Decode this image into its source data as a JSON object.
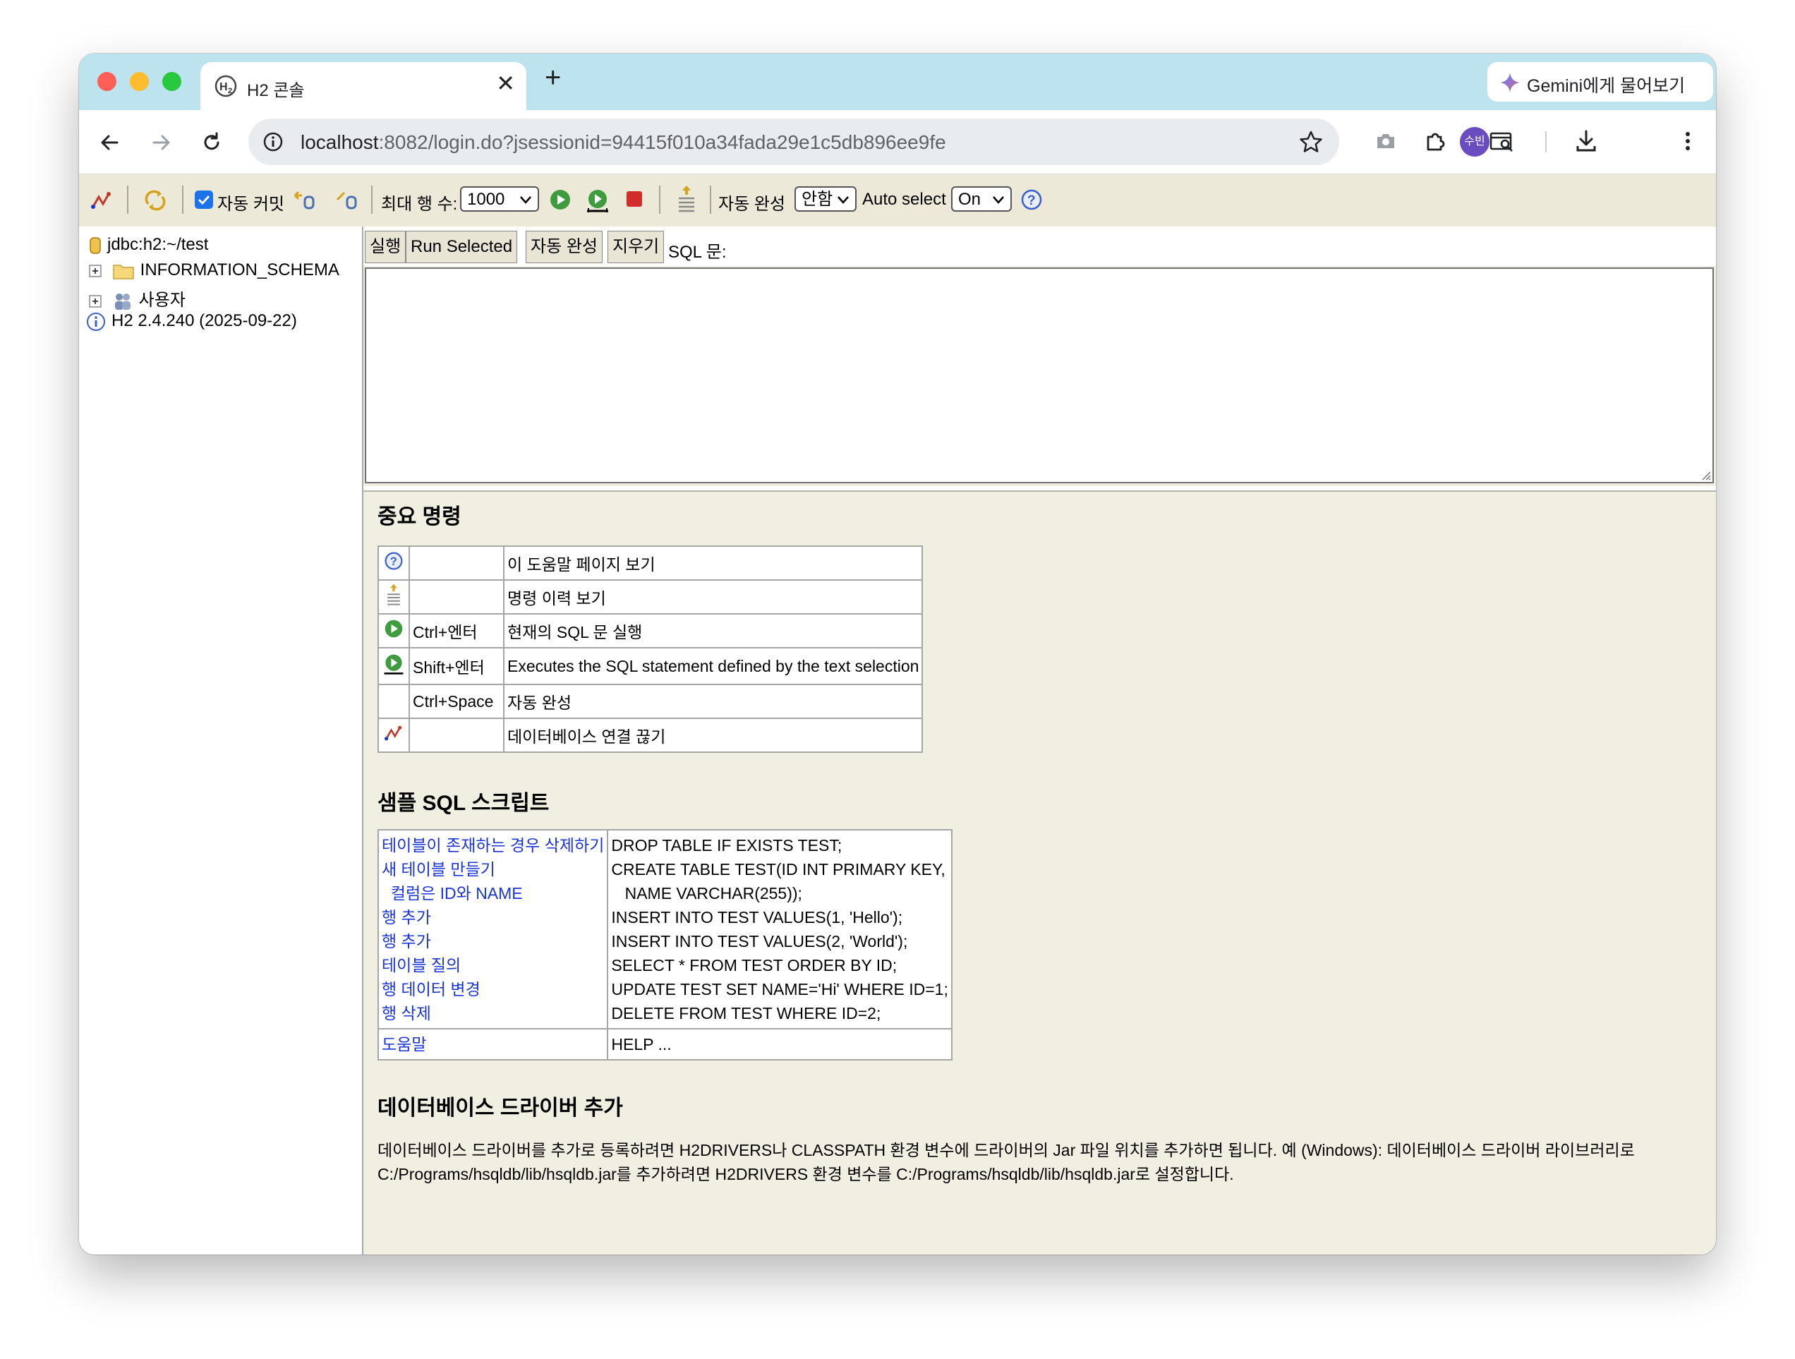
{
  "browser": {
    "tab_title": "H2 콘솔",
    "gemini_label": "Gemini에게 물어보기",
    "url_host": "localhost",
    "url_rest": ":8082/login.do?jsessionid=94415f010a34fada29e1c5db896ee9fe",
    "profile_initials": "수빈"
  },
  "h2toolbar": {
    "autocommit_label": "자동 커밋",
    "maxrows_label": "최대 행 수:",
    "maxrows_value": "1000",
    "autocomplete_label": "자동 완성",
    "autocomplete_value": "안함",
    "autoselect_label": "Auto select",
    "autoselect_value": "On"
  },
  "tree": {
    "connection": "jdbc:h2:~/test",
    "schema": "INFORMATION_SCHEMA",
    "users": "사용자",
    "version": "H2 2.4.240 (2025-09-22)"
  },
  "command_bar": {
    "run": "실행",
    "run_selected": "Run Selected",
    "autocomplete": "자동 완성",
    "clear": "지우기",
    "sql_label": "SQL 문:"
  },
  "help": {
    "important_title": "중요 명령",
    "commands": [
      {
        "icon": "help-icon",
        "key": "",
        "desc": "이 도움말 페이지 보기"
      },
      {
        "icon": "history-icon",
        "key": "",
        "desc": "명령 이력 보기"
      },
      {
        "icon": "run-icon",
        "key": "Ctrl+엔터",
        "desc": "현재의 SQL 문 실행"
      },
      {
        "icon": "run-selected-icon",
        "key": "Shift+엔터",
        "desc": "Executes the SQL statement defined by the text selection"
      },
      {
        "icon": "",
        "key": "Ctrl+Space",
        "desc": "자동 완성"
      },
      {
        "icon": "disconnect-icon",
        "key": "",
        "desc": "데이터베이스 연결 끊기"
      }
    ],
    "sample_title": "샘플 SQL 스크립트",
    "sample_links": [
      "테이블이 존재하는 경우 삭제하기",
      "새 테이블 만들기",
      "  컬럼은 ID와 NAME",
      "행 추가",
      "행 추가",
      "테이블 질의",
      "행 데이터 변경",
      "행 삭제"
    ],
    "sample_code": [
      "DROP TABLE IF EXISTS TEST;",
      "CREATE TABLE TEST(ID INT PRIMARY KEY,",
      "   NAME VARCHAR(255));",
      "INSERT INTO TEST VALUES(1, 'Hello');",
      "INSERT INTO TEST VALUES(2, 'World');",
      "SELECT * FROM TEST ORDER BY ID;",
      "UPDATE TEST SET NAME='Hi' WHERE ID=1;",
      "DELETE FROM TEST WHERE ID=2;"
    ],
    "help_link": "도움말",
    "help_code": "HELP ...",
    "driver_title": "데이터베이스 드라이버 추가",
    "driver_line1": "데이터베이스 드라이버를 추가로 등록하려면 H2DRIVERS나 CLASSPATH 환경 변수에 드라이버의 Jar 파일 위치를 추가하면 됩니다. 예 (Windows): 데이터베이스 드라이버 라이브러리로",
    "driver_line2": "C:/Programs/hsqldb/lib/hsqldb.jar를 추가하려면 H2DRIVERS 환경 변수를 C:/Programs/hsqldb/lib/hsqldb.jar로 설정합니다."
  },
  "colors": {
    "tabstrip": "#bde3ee",
    "h2_background": "#ece9d8",
    "help_background": "#f1efe1",
    "link": "#1a34d8"
  }
}
